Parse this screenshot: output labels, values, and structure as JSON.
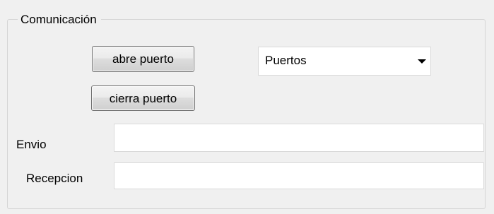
{
  "group": {
    "title": "Comunicación"
  },
  "buttons": {
    "open_label": "abre puerto",
    "close_label": "cierra puerto"
  },
  "ports_combo": {
    "selected_value": "Puertos",
    "arrow_icon": "dropdown-arrow-icon"
  },
  "fields": {
    "send_label": "Envio",
    "send_value": "",
    "receive_label": "Recepcion",
    "receive_value": ""
  }
}
